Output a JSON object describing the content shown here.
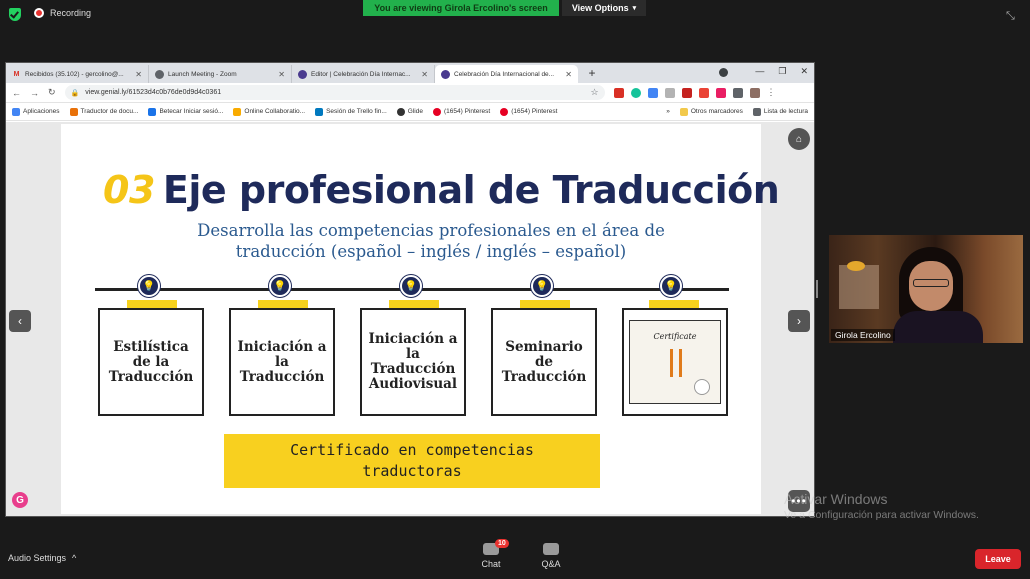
{
  "zoom": {
    "recording_label": "Recording",
    "viewing_banner": "You are viewing Girola Ercolino's screen",
    "view_options": "View Options",
    "participant_name": "Girola Ercolino",
    "audio_settings": "Audio Settings",
    "chat_label": "Chat",
    "chat_badge": "10",
    "qa_label": "Q&A",
    "leave_label": "Leave"
  },
  "browser": {
    "tabs": [
      {
        "icon": "gmail-icon",
        "label": "Recibidos (35.102) - gercolino@..."
      },
      {
        "icon": "globe-icon",
        "label": "Launch Meeting - Zoom"
      },
      {
        "icon": "genially-icon",
        "label": "Editor | Celebración Día Internac..."
      },
      {
        "icon": "genially-icon",
        "label": "Celebración Día Internacional de..."
      }
    ],
    "url": "view.genial.ly/61523d4c0b76de0d9d4c0361",
    "bookmarks": [
      {
        "label": "Aplicaciones",
        "color": "#4285f4"
      },
      {
        "label": "Traductor de docu...",
        "color": "#e8710a"
      },
      {
        "label": "Betecar Iniciar sesió...",
        "color": "#1a73e8"
      },
      {
        "label": "Online Collaboratio...",
        "color": "#f9ab00"
      },
      {
        "label": "Sesión de Trello fin...",
        "color": "#0079bf"
      },
      {
        "label": "Glide",
        "color": "#333333"
      },
      {
        "label": "(1654) Pinterest",
        "color": "#e60023"
      },
      {
        "label": "(1654) Pinterest",
        "color": "#e60023"
      }
    ],
    "bookmarks_overflow": "»",
    "other_bookmarks": "Otros marcadores",
    "reading_list": "Lista de lectura"
  },
  "slide": {
    "number": "03",
    "title": "Eje profesional de Traducción",
    "subtitle_line1": "Desarrolla las competencias profesionales en el área de",
    "subtitle_line2": "traducción (español – inglés / inglés – español)",
    "cards": [
      {
        "line1": "Estilística",
        "line2": "de la",
        "line3": "Traducción"
      },
      {
        "line1": "Iniciación a",
        "line2": "la",
        "line3": "Traducción"
      },
      {
        "line1": "Iniciación a",
        "line2": "la",
        "line3": "Traducción",
        "line4": "Audiovisual"
      },
      {
        "line1": "Seminario",
        "line2": "de",
        "line3": "Traducción"
      }
    ],
    "certificate_label": "Certificate",
    "banner_line1": "Certificado en competencias",
    "banner_line2": "traductoras"
  },
  "watermark": {
    "line1": "Activar Windows",
    "line2": "Ve a Configuración para activar Windows."
  },
  "colors": {
    "slide_title": "#1e2a5a",
    "slide_accent": "#f5c518",
    "subtitle": "#2b5a8f",
    "banner": "#f8d01f",
    "zoom_green": "#22b14c",
    "leave_red": "#d9252b"
  }
}
